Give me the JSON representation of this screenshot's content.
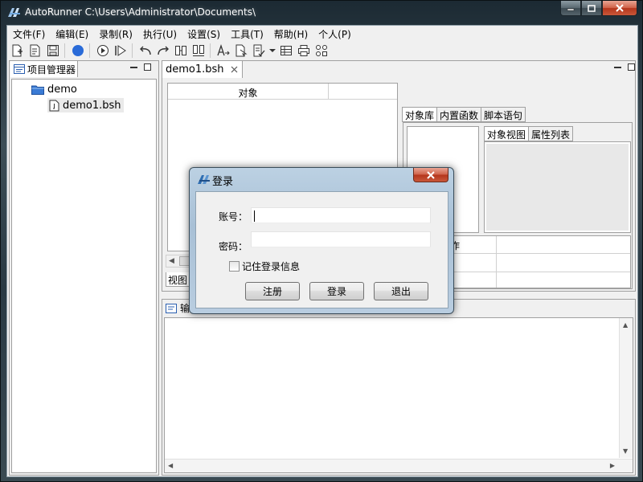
{
  "window": {
    "title": "AutoRunner  C:\\Users\\Administrator\\Documents\\",
    "accent_color": "#2a3a44"
  },
  "menubar": {
    "items": [
      "文件(F)",
      "编辑(E)",
      "录制(R)",
      "执行(U)",
      "设置(S)",
      "工具(T)",
      "帮助(H)",
      "个人(P)"
    ]
  },
  "toolbar": {
    "icons": [
      "new-project-icon",
      "new-script-icon",
      "save-icon",
      "record-icon",
      "run-icon",
      "step-run-icon",
      "undo-icon",
      "redo-icon",
      "compare-icon",
      "compare-object-icon",
      "insert-text-icon",
      "insert-object-icon",
      "script-check-icon",
      "dropdown-icon",
      "table-icon",
      "print-icon",
      "network-icon"
    ]
  },
  "project_panel": {
    "tab_label": "项目管理器",
    "tree": {
      "folder": "demo",
      "file": "demo1.bsh"
    }
  },
  "editor": {
    "tab_label": "demo1.bsh",
    "object_column": "对象",
    "view_tab": "视图",
    "right_tabs": [
      "对象库",
      "内置函数",
      "脚本语句"
    ],
    "inner_tabs": [
      "对象视图",
      "属性列表"
    ],
    "prop_header_partial": "作"
  },
  "output_panel": {
    "tab_label_partial": "输"
  },
  "login_dialog": {
    "title": "登录",
    "account_label": "账号：",
    "account_value": "",
    "password_label": "密码：",
    "password_value": "",
    "remember_label": "记住登录信息",
    "remember_checked": false,
    "register_button": "注册",
    "login_button": "登录",
    "exit_button": "退出"
  }
}
